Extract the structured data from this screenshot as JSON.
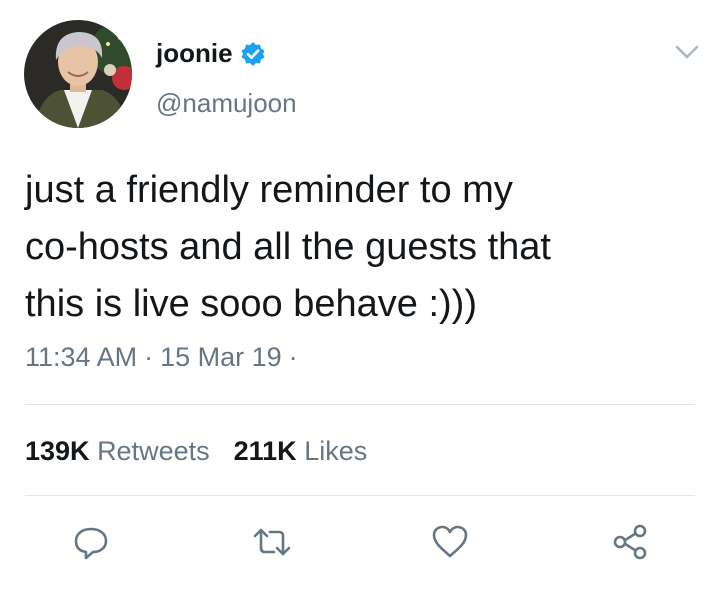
{
  "author": {
    "display_name": "joonie",
    "handle": "@namujoon",
    "verified": true
  },
  "tweet": {
    "text_lines": [
      "just a friendly reminder to my",
      "co-hosts and all the guests that",
      "this is live sooo behave :)))"
    ],
    "time": "11:34 AM",
    "date": "15 Mar 19",
    "separator": "·"
  },
  "stats": {
    "retweets_count": "139K",
    "retweets_label": "Retweets",
    "likes_count": "211K",
    "likes_label": "Likes"
  },
  "icons": {
    "verified": "verified-badge-icon",
    "menu": "chevron-down-icon",
    "reply": "reply-icon",
    "retweet": "retweet-icon",
    "like": "heart-icon",
    "share": "share-icon"
  },
  "colors": {
    "text": "#14171a",
    "secondary": "#657786",
    "verified": "#1da1f2",
    "divider": "#e1e8ed",
    "icon": "#657786"
  }
}
